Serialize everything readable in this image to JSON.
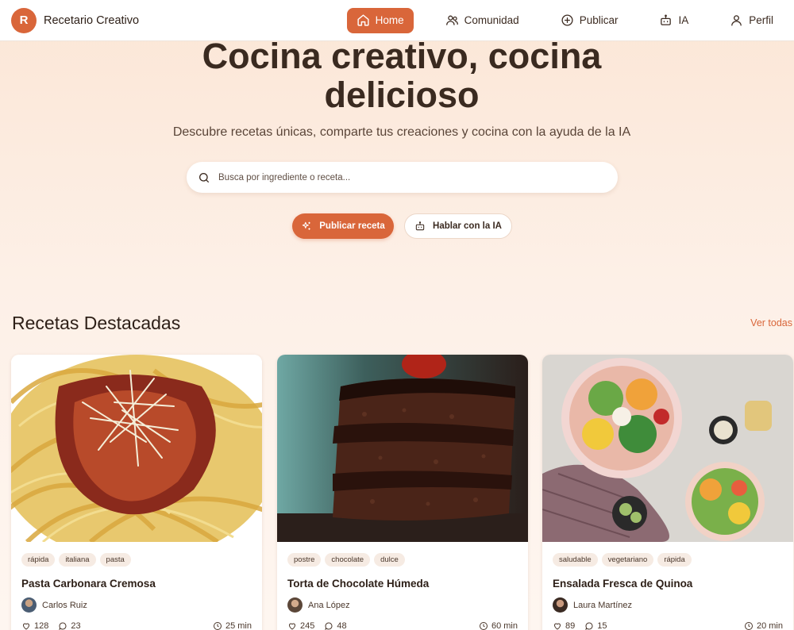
{
  "app": {
    "logo_letter": "R",
    "name": "Recetario Creativo"
  },
  "nav": [
    {
      "label": "Home",
      "icon": "home-icon",
      "active": true
    },
    {
      "label": "Comunidad",
      "icon": "users-icon",
      "active": false
    },
    {
      "label": "Publicar",
      "icon": "plus-circle-icon",
      "active": false
    },
    {
      "label": "IA",
      "icon": "robot-icon",
      "active": false
    },
    {
      "label": "Perfil",
      "icon": "user-icon",
      "active": false
    }
  ],
  "hero": {
    "title_line1": "Cocina creativo, cocina",
    "title_line2": "delicioso",
    "subtitle": "Descubre recetas únicas, comparte tus creaciones y cocina con la ayuda de la IA",
    "search_placeholder": "Busca por ingrediente o receta...",
    "primary_button": "Publicar receta",
    "secondary_button": "Hablar con la IA"
  },
  "featured": {
    "title": "Recetas Destacadas",
    "see_all": "Ver todas",
    "recipes": [
      {
        "title": "Pasta Carbonara Cremosa",
        "tags": [
          "rápida",
          "italiana",
          "pasta"
        ],
        "author": "Carlos Ruiz",
        "likes": "128",
        "comments": "23",
        "time": "25 min"
      },
      {
        "title": "Torta de Chocolate Húmeda",
        "tags": [
          "postre",
          "chocolate",
          "dulce"
        ],
        "author": "Ana López",
        "likes": "245",
        "comments": "48",
        "time": "60 min"
      },
      {
        "title": "Ensalada Fresca de Quinoa",
        "tags": [
          "saludable",
          "vegetariano",
          "rápida"
        ],
        "author": "Laura Martínez",
        "likes": "89",
        "comments": "15",
        "time": "20 min"
      }
    ]
  },
  "colors": {
    "accent": "#d9663a",
    "background": "#fbe6d6",
    "text": "#3b2a20"
  }
}
